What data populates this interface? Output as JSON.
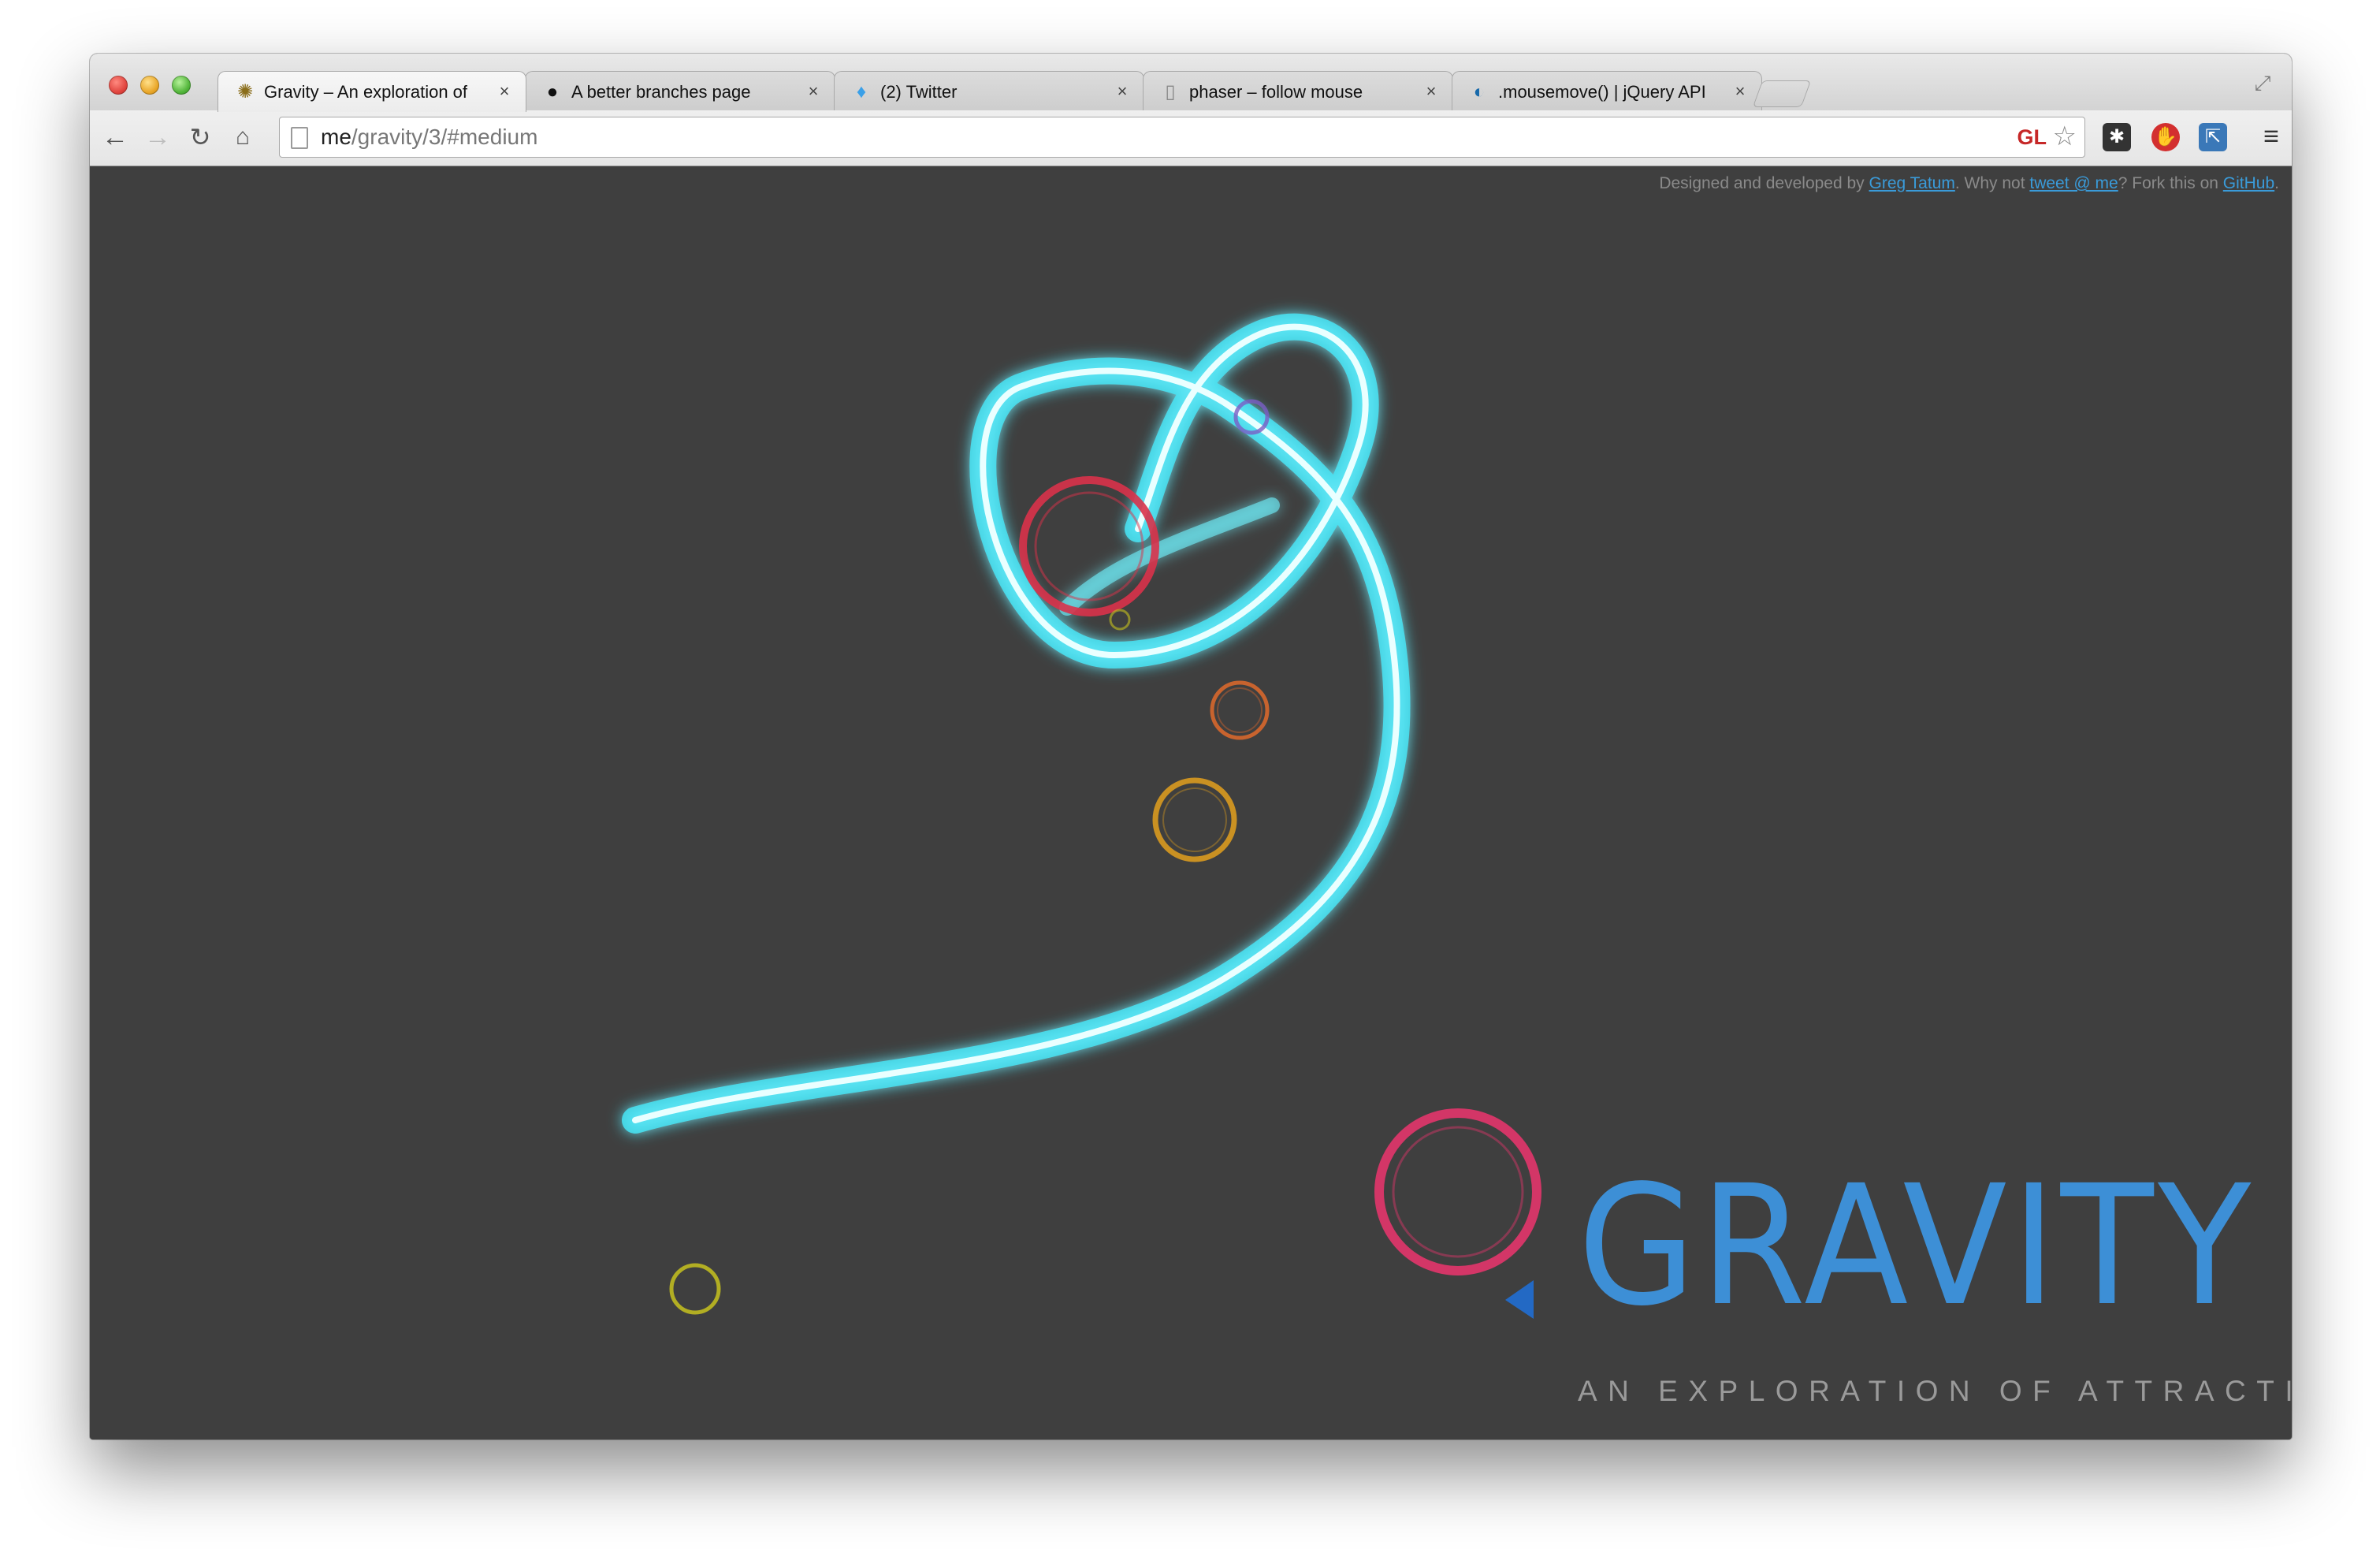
{
  "browser": {
    "tabs": [
      {
        "favicon": "gravity-favicon",
        "title": "Gravity – An exploration of",
        "active": true
      },
      {
        "favicon": "github-icon",
        "title": "A better branches page",
        "active": false
      },
      {
        "favicon": "twitter-icon",
        "title": "(2) Twitter",
        "active": false
      },
      {
        "favicon": "page-icon",
        "title": "phaser – follow mouse",
        "active": false
      },
      {
        "favicon": "jquery-icon",
        "title": ".mousemove() | jQuery API",
        "active": false
      }
    ],
    "close_glyph": "×",
    "url_host": "me",
    "url_path": "/gravity/3/#medium",
    "gl_badge": "GL"
  },
  "page": {
    "credit": {
      "prefix": "Designed and developed by ",
      "author": "Greg Tatum",
      "middle1": ". Why not ",
      "tweet": "tweet @ me",
      "middle2": "? Fork this on ",
      "github": "GitHub",
      "suffix": "."
    },
    "logo_title": "GRAVITY",
    "logo_subtitle": "AN EXPLORATION OF ATTRACTION",
    "colors": {
      "background": "#3f3f3f",
      "trail": "#5ff3ff",
      "accent": "#3d8fd6"
    },
    "attractors": [
      {
        "color": "#d9324a",
        "label": "red-attractor"
      },
      {
        "color": "#e06a2c",
        "label": "orange-attractor"
      },
      {
        "color": "#d99a1f",
        "label": "amber-attractor"
      },
      {
        "color": "#c7c21e",
        "label": "yellow-attractor"
      },
      {
        "color": "#e0356a",
        "label": "pink-attractor"
      },
      {
        "color": "#7a5cc4",
        "label": "purple-attractor"
      }
    ]
  }
}
